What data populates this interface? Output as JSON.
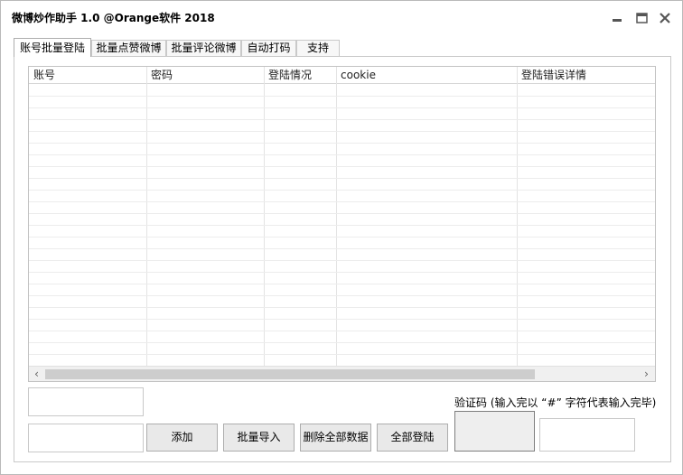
{
  "window": {
    "title": "微博炒作助手 1.0 @Orange软件 2018"
  },
  "tabs": [
    {
      "label": "账号批量登陆",
      "active": true
    },
    {
      "label": "批量点赞微博",
      "active": false
    },
    {
      "label": "批量评论微博",
      "active": false
    },
    {
      "label": "自动打码",
      "active": false
    },
    {
      "label": "支持",
      "active": false
    }
  ],
  "table": {
    "columns": [
      "账号",
      "密码",
      "登陆情况",
      "cookie",
      "登陆错误详情"
    ],
    "rows": []
  },
  "form": {
    "account_value": "",
    "password_value": "",
    "add_label": "添加",
    "import_label": "批量导入",
    "clear_label": "删除全部数据",
    "login_all_label": "全部登陆",
    "captcha_label": "验证码 (输入完以 “#” 字符代表输入完毕)",
    "captcha_value": ""
  },
  "colors": {
    "button_bg": "#e9e9e9",
    "border": "#c8c8c8",
    "scroll_thumb": "#cdcdcd"
  }
}
